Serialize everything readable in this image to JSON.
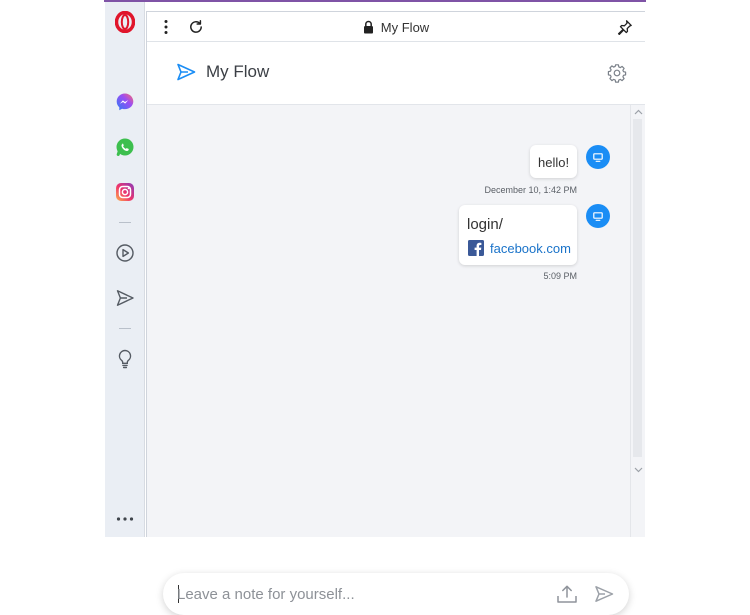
{
  "window": {
    "accent_color": "#7f53a6",
    "title": "My Flow"
  },
  "sidebar": {
    "items": [
      {
        "name": "opera-logo",
        "icon": "opera-o-icon",
        "color": "#e0152b"
      },
      {
        "name": "messenger",
        "icon": "messenger-icon"
      },
      {
        "name": "whatsapp",
        "icon": "whatsapp-icon",
        "color": "#3dbf4e"
      },
      {
        "name": "instagram",
        "icon": "instagram-icon"
      },
      {
        "name": "player",
        "icon": "play-circle-icon"
      },
      {
        "name": "my-flow",
        "icon": "send-icon"
      },
      {
        "name": "pinboard",
        "icon": "lightbulb-icon"
      },
      {
        "name": "more",
        "icon": "more-dots-icon"
      }
    ]
  },
  "topbar": {
    "title": "My Flow",
    "menu_icon": "kebab-menu-icon",
    "reload_icon": "reload-icon",
    "lock_icon": "lock-icon",
    "pin_icon": "pin-icon"
  },
  "header": {
    "title": "My Flow",
    "icon": "send-icon",
    "settings_icon": "gear-icon",
    "accent": "#1a8df5"
  },
  "messages": [
    {
      "text": "hello!",
      "timestamp": "December 10, 1:42 PM"
    },
    {
      "title": "login/",
      "link_text": "facebook.com",
      "link_icon": "facebook-icon",
      "timestamp": "5:09 PM"
    }
  ],
  "composer": {
    "placeholder": "Leave a note for yourself...",
    "upload_icon": "upload-icon",
    "send_icon": "send-icon"
  }
}
